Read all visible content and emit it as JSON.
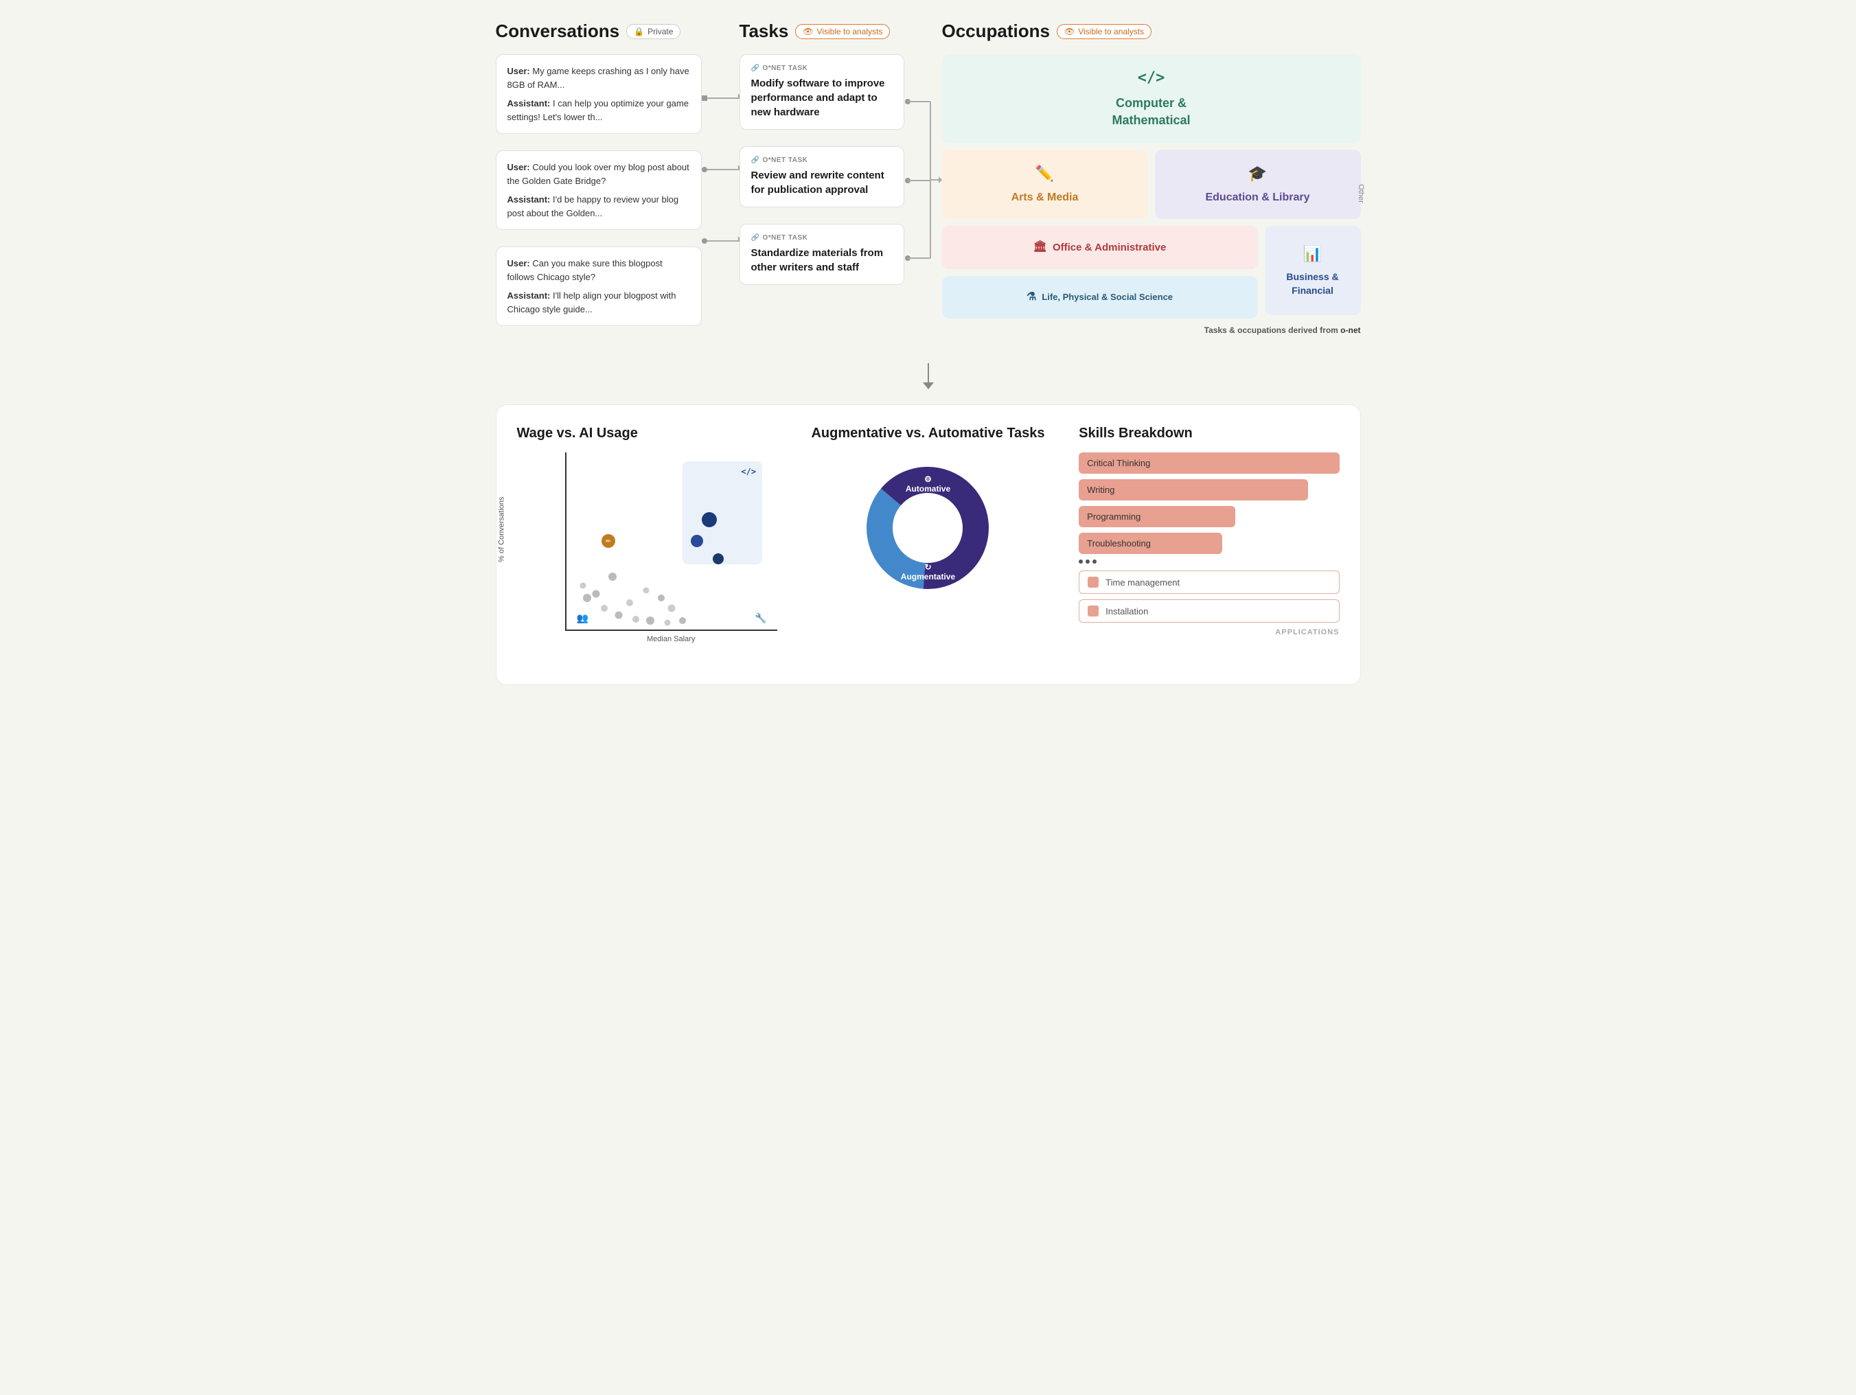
{
  "header": {
    "conversations_title": "Conversations",
    "conversations_badge": "Private",
    "tasks_title": "Tasks",
    "tasks_badge": "Visible to analysts",
    "occupations_title": "Occupations",
    "occupations_badge": "Visible to analysts"
  },
  "conversations": [
    {
      "id": "conv1",
      "user_text": "My game keeps crashing as I only have 8GB of RAM...",
      "assistant_text": "I can help you optimize your game settings! Let's lower th..."
    },
    {
      "id": "conv2",
      "user_text": "Could you look over my blog post about the Golden Gate Bridge?",
      "assistant_text": "I'd be happy to review your blog post about the Golden..."
    },
    {
      "id": "conv3",
      "user_text": "Can you make sure this blogpost follows Chicago style?",
      "assistant_text": "I'll help align your blogpost with Chicago style guide..."
    }
  ],
  "tasks": [
    {
      "id": "task1",
      "label": "O*NET TASK",
      "text": "Modify software to improve performance and adapt to new hardware"
    },
    {
      "id": "task2",
      "label": "O*NET TASK",
      "text": "Review and rewrite content for publication approval"
    },
    {
      "id": "task3",
      "label": "O*NET TASK",
      "text": "Standardize materials from other writers and staff"
    }
  ],
  "occupations": [
    {
      "id": "occ-computer",
      "name": "Computer & Mathematical",
      "icon": "</>",
      "color_class": "occ-computer"
    },
    {
      "id": "occ-arts",
      "name": "Arts & Media",
      "icon": "✏️",
      "color_class": "occ-arts"
    },
    {
      "id": "occ-education",
      "name": "Education & Library",
      "icon": "🎓",
      "color_class": "occ-education"
    },
    {
      "id": "occ-office",
      "name": "Office & Administrative",
      "icon": "🏛",
      "color_class": "occ-office"
    },
    {
      "id": "occ-business",
      "name": "Business & Financial",
      "icon": "📊",
      "color_class": "occ-business"
    },
    {
      "id": "occ-life",
      "name": "Life, Physical & Social Science",
      "icon": "⚗",
      "color_class": "occ-life"
    }
  ],
  "source_note": "Tasks & occupations derived from",
  "source_link": "o-net",
  "charts": {
    "wage": {
      "title": "Wage vs. AI Usage",
      "y_label": "% of Conversations",
      "x_label": "Median Salary"
    },
    "donut": {
      "title": "Augmentative vs. Automative Tasks",
      "automative_label": "Automative",
      "augmentative_label": "Augmentative",
      "automative_pct": 65,
      "augmentative_pct": 35
    },
    "skills": {
      "title": "Skills Breakdown",
      "bars": [
        {
          "label": "Critical Thinking",
          "width": 100
        },
        {
          "label": "Writing",
          "width": 88
        },
        {
          "label": "Programming",
          "width": 60
        },
        {
          "label": "Troubleshooting",
          "width": 55
        }
      ],
      "outline_items": [
        {
          "label": "Time management"
        },
        {
          "label": "Installation"
        }
      ],
      "footer": "APPLICATIONS"
    }
  },
  "labels": {
    "user": "User:",
    "assistant": "Assistant:",
    "onet_task": "O*NET TASK",
    "other": "Other",
    "private": "Private",
    "visible_to_analysts": "Visible to analysts"
  }
}
